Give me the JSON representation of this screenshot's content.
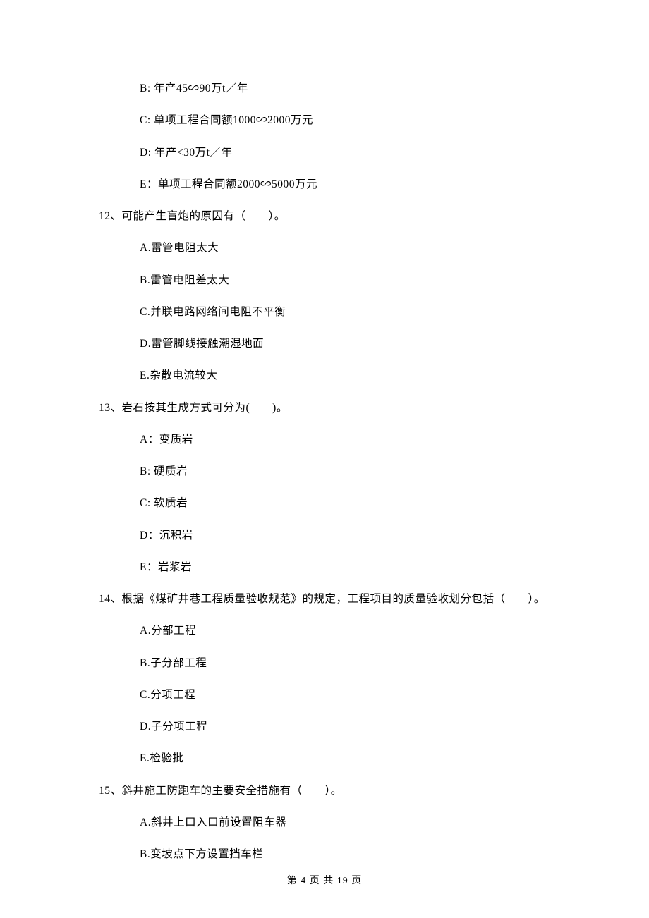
{
  "options_top": [
    "B: 年产45∽90万t／年",
    "C: 单项工程合同额1000∽2000万元",
    "D: 年产<30万t／年",
    "E：单项工程合同额2000∽5000万元"
  ],
  "q12": {
    "stem": "12、可能产生盲炮的原因有（　　）。",
    "opts": [
      "A.雷管电阻太大",
      "B.雷管电阻差太大",
      "C.并联电路网络间电阻不平衡",
      "D.雷管脚线接触潮湿地面",
      "E.杂散电流较大"
    ]
  },
  "q13": {
    "stem": "13、岩石按其生成方式可分为(　　)。",
    "opts": [
      "A：变质岩",
      "B: 硬质岩",
      "C: 软质岩",
      "D：沉积岩",
      "E：岩浆岩"
    ]
  },
  "q14": {
    "stem": "14、根据《煤矿井巷工程质量验收规范》的规定，工程项目的质量验收划分包括（　　）。",
    "opts": [
      "A.分部工程",
      "B.子分部工程",
      "C.分项工程",
      "D.子分项工程",
      "E.检验批"
    ]
  },
  "q15": {
    "stem": "15、斜井施工防跑车的主要安全措施有（　　）。",
    "opts": [
      "A.斜井上口入口前设置阻车器",
      "B.变坡点下方设置挡车栏"
    ]
  },
  "footer": "第 4 页 共 19 页"
}
